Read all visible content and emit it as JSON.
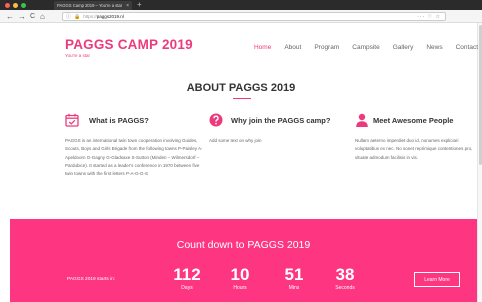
{
  "browser": {
    "tab_title": "PAGGS Camp 2019 – You're a star",
    "tab_close": "×",
    "new_tab": "+",
    "url_protocol": "https://",
    "url_host": "paggs2019.nl",
    "url_actions": "··· ♡ ☆",
    "nav": {
      "back": "←",
      "forward": "→",
      "reload": "C",
      "home": "⌂"
    }
  },
  "site": {
    "logo_title": "PAGGS CAMP 2019",
    "logo_tagline": "You're a star",
    "nav": [
      "Home",
      "About",
      "Program",
      "Campsite",
      "Gallery",
      "News",
      "Contact"
    ],
    "active_nav": "Home"
  },
  "about": {
    "title": "ABOUT PAGGS 2019",
    "features": [
      {
        "icon": "calendar-check-icon",
        "heading": "What is PAGGS?",
        "text": "PAGGS is an international twin town cooperation involving Guides, Scouts, Boys and Girls Brigade from the following towns P-Paisley A-Apeldoorn G-Gagny G-Gladsaxe S-Sutton (Minden – Wilmersdorf – Pardubice). It started as a leader's conference in 1970 between five twin towns with the first letters P-A-G-G-S"
      },
      {
        "icon": "question-circle-icon",
        "heading": "Why join the PAGGS camp?",
        "text": "Add some text on why join"
      },
      {
        "icon": "user-icon",
        "heading": "Meet Awesome People",
        "text": "Nullam aeterno imperdiet duo id, nonumes expliciari voluptatibus ex nec. No sonet reprimique contentiones pro, vituate admodum facilisis in vis."
      }
    ]
  },
  "countdown": {
    "title": "Count down to PAGGS 2019",
    "starts_label": "PAGGS 2019 starts in:",
    "units": [
      {
        "value": "112",
        "label": "Days"
      },
      {
        "value": "10",
        "label": "Hours"
      },
      {
        "value": "51",
        "label": "Mins"
      },
      {
        "value": "38",
        "label": "Seconds"
      }
    ],
    "button_label": "Learn More"
  },
  "colors": {
    "accent": "#ec3b7c",
    "countdown_bg": "#fe3581"
  }
}
